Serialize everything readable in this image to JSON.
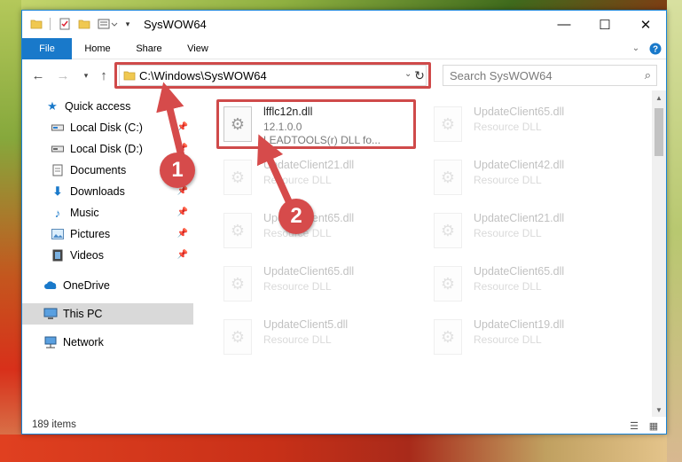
{
  "window": {
    "title": "SysWOW64",
    "minimize_glyph": "—",
    "maximize_glyph": "☐",
    "close_glyph": "✕"
  },
  "ribbon": {
    "tabs": [
      {
        "label": "File"
      },
      {
        "label": "Home"
      },
      {
        "label": "Share"
      },
      {
        "label": "View"
      }
    ]
  },
  "address": {
    "path": "C:\\Windows\\SysWOW64",
    "search_placeholder": "Search SysWOW64"
  },
  "nav": {
    "items": [
      {
        "label": "Quick access",
        "icon": "star-icon"
      },
      {
        "label": "Local Disk (C:)",
        "icon": "drive-icon",
        "pinned": true
      },
      {
        "label": "Local Disk (D:)",
        "icon": "drive-icon",
        "pinned": true
      },
      {
        "label": "Documents",
        "icon": "documents-icon",
        "pinned": true
      },
      {
        "label": "Downloads",
        "icon": "downloads-icon",
        "pinned": true
      },
      {
        "label": "Music",
        "icon": "music-icon",
        "pinned": true
      },
      {
        "label": "Pictures",
        "icon": "pictures-icon",
        "pinned": true
      },
      {
        "label": "Videos",
        "icon": "videos-icon",
        "pinned": true
      },
      {
        "label": "OneDrive",
        "icon": "cloud-icon"
      },
      {
        "label": "This PC",
        "icon": "computer-icon",
        "selected": true
      },
      {
        "label": "Network",
        "icon": "network-icon"
      }
    ]
  },
  "files": [
    {
      "name": "lfflc12n.dll",
      "version": "12.1.0.0",
      "desc": "LEADTOOLS(r) DLL fo..."
    },
    {
      "name": "UpdateClient65.dll",
      "desc": "Resource DLL"
    },
    {
      "name": "UpdateClient21.dll",
      "desc": "Resource DLL"
    },
    {
      "name": "UpdateClient42.dll",
      "desc": "Resource DLL"
    },
    {
      "name": "UpdateClient65.dll",
      "desc": "Resource DLL"
    },
    {
      "name": "UpdateClient21.dll",
      "desc": "Resource DLL"
    },
    {
      "name": "UpdateClient65.dll",
      "desc": "Resource DLL"
    },
    {
      "name": "UpdateClient65.dll",
      "desc": "Resource DLL"
    },
    {
      "name": "UpdateClient5.dll",
      "desc": "Resource DLL"
    },
    {
      "name": "UpdateClient19.dll",
      "desc": "Resource DLL"
    }
  ],
  "status": {
    "item_count": "189 items"
  },
  "callouts": [
    {
      "number": "1"
    },
    {
      "number": "2"
    }
  ],
  "colors": {
    "accent": "#1979ca",
    "highlight": "#cf4a4a",
    "selected_bg": "#d9d9d9"
  }
}
